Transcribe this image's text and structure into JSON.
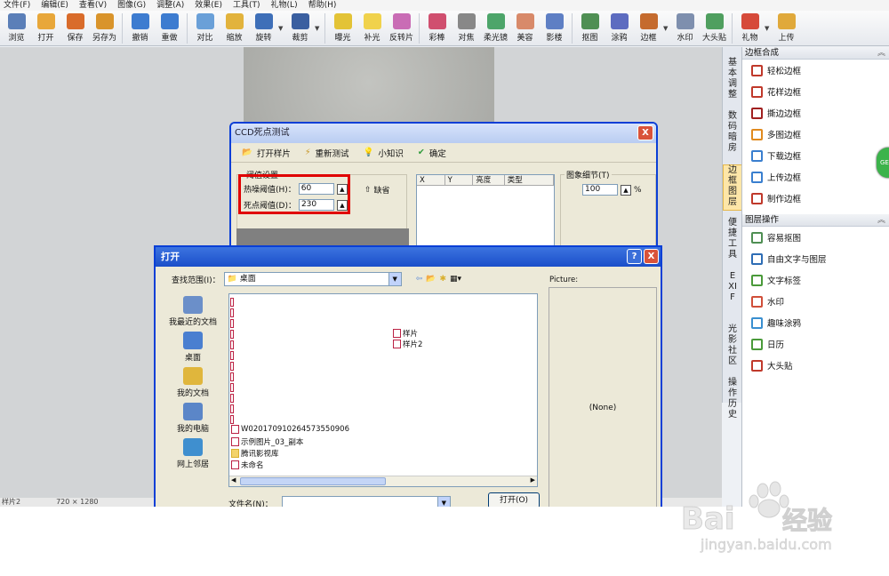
{
  "menu": [
    "文件(F)",
    "编辑(E)",
    "查看(V)",
    "图像(G)",
    "调整(A)",
    "效果(E)",
    "工具(T)",
    "礼物(L)",
    "帮助(H)"
  ],
  "toolbar": [
    {
      "label": "浏览",
      "icon": "browse-icon",
      "color": "#5b7fb8"
    },
    {
      "label": "打开",
      "icon": "open-icon",
      "color": "#e8a73a"
    },
    {
      "label": "保存",
      "icon": "save-icon",
      "color": "#d96c2b"
    },
    {
      "label": "另存为",
      "icon": "save-as-icon",
      "color": "#d9942b"
    },
    {
      "label": "撤销",
      "icon": "undo-icon",
      "color": "#3d7cd0"
    },
    {
      "label": "重做",
      "icon": "redo-icon",
      "color": "#3d7cd0"
    },
    {
      "label": "对比",
      "icon": "compare-icon",
      "color": "#6aa0d8"
    },
    {
      "label": "缩放",
      "icon": "zoom-icon",
      "color": "#e2b33c"
    },
    {
      "label": "旋转",
      "icon": "rotate-icon",
      "color": "#3e6fb8"
    },
    {
      "label": "裁剪",
      "icon": "crop-icon",
      "color": "#3a5fa0"
    },
    {
      "label": "曝光",
      "icon": "exposure-icon",
      "color": "#e3c336"
    },
    {
      "label": "补光",
      "icon": "fill-light-icon",
      "color": "#f0d24c"
    },
    {
      "label": "反转片",
      "icon": "reversal-film-icon",
      "color": "#c96cb5"
    },
    {
      "label": "彩棒",
      "icon": "color-wand-icon",
      "color": "#d04f6f"
    },
    {
      "label": "对焦",
      "icon": "focus-icon",
      "color": "#888888"
    },
    {
      "label": "柔光镜",
      "icon": "soft-lens-icon",
      "color": "#4da56a"
    },
    {
      "label": "美容",
      "icon": "beauty-icon",
      "color": "#d88a6a"
    },
    {
      "label": "影楼",
      "icon": "studio-icon",
      "color": "#5e7fc4"
    },
    {
      "label": "抠图",
      "icon": "cutout-icon",
      "color": "#4f8f53"
    },
    {
      "label": "涂鸦",
      "icon": "doodle-icon",
      "color": "#5d6cc0"
    },
    {
      "label": "边框",
      "icon": "frame-icon",
      "color": "#c56b2e"
    },
    {
      "label": "水印",
      "icon": "watermark-icon",
      "color": "#7e8fae"
    },
    {
      "label": "大头贴",
      "icon": "sticker-icon",
      "color": "#4f9f5f"
    },
    {
      "label": "礼物",
      "icon": "gift-icon",
      "color": "#d64a3a"
    },
    {
      "label": "上传",
      "icon": "upload-icon",
      "color": "#e0a93b"
    }
  ],
  "status": {
    "left": "样片2",
    "size": "720 × 1280"
  },
  "vtabs": [
    {
      "label": "基本调整",
      "active": false
    },
    {
      "label": "数码暗房",
      "active": false
    },
    {
      "label": "边框图层",
      "active": true
    },
    {
      "label": "便捷工具",
      "active": false
    },
    {
      "label": "EXIF",
      "active": false
    },
    {
      "label": "光影社区",
      "active": false
    },
    {
      "label": "操作历史",
      "active": false
    }
  ],
  "panel": {
    "frame_title": "边框合成",
    "frame_items": [
      {
        "label": "轻松边框",
        "icon": "easy-frame-icon",
        "color": "#c0392b"
      },
      {
        "label": "花样边框",
        "icon": "pattern-frame-icon",
        "color": "#c0392b"
      },
      {
        "label": "撕边边框",
        "icon": "torn-frame-icon",
        "color": "#a02020"
      },
      {
        "label": "多图边框",
        "icon": "multi-frame-icon",
        "color": "#e08a1e"
      },
      {
        "label": "下载边框",
        "icon": "download-frame-icon",
        "color": "#3a7fcf"
      },
      {
        "label": "上传边框",
        "icon": "upload-frame-icon",
        "color": "#3a7fcf"
      },
      {
        "label": "制作边框",
        "icon": "make-frame-icon",
        "color": "#c0392b"
      }
    ],
    "layer_title": "图层操作",
    "layer_items": [
      {
        "label": "容易抠图",
        "icon": "easy-cutout-icon",
        "color": "#4f8f53"
      },
      {
        "label": "自由文字与图层",
        "icon": "text-layer-icon",
        "color": "#2e6db5"
      },
      {
        "label": "文字标签",
        "icon": "text-tag-icon",
        "color": "#4a9a3a"
      },
      {
        "label": "水印",
        "icon": "watermark-icon",
        "color": "#d04f3a"
      },
      {
        "label": "趣味涂鸦",
        "icon": "fun-doodle-icon",
        "color": "#3a8fd0"
      },
      {
        "label": "日历",
        "icon": "calendar-icon",
        "color": "#4a9a3a"
      },
      {
        "label": "大头贴",
        "icon": "sticker-icon",
        "color": "#c0392b"
      }
    ]
  },
  "ccd": {
    "title": "CCD死点测试",
    "close": "X",
    "open_sample": "打开样片",
    "retest": "重新测试",
    "tips": "小知识",
    "ok": "确定",
    "threshold_group": "阈值设置",
    "hot_label": "热噪阈值(H)：",
    "hot_value": "60",
    "dead_label": "死点阈值(D)：",
    "dead_value": "230",
    "default_btn": "缺省",
    "cols": [
      "X",
      "Y",
      "亮度",
      "类型"
    ],
    "detail_group": "图象细节(T)",
    "detail_value": "100",
    "detail_unit": "%"
  },
  "open": {
    "title": "打开",
    "look_in_label": "查找范围(I)：",
    "look_in_value": "桌面",
    "places": [
      "我最近的文档",
      "桌面",
      "我的文档",
      "我的电脑",
      "网上邻居"
    ],
    "files_right": [
      "样片",
      "样片2"
    ],
    "files_bottom": [
      "W020170910264573550906",
      "示例图片_03_副本",
      "腾讯影视库",
      "未命名"
    ],
    "preview_label": "Picture:",
    "preview_none": "(None)",
    "filename_label": "文件名(N)：",
    "open_btn": "打开(O)",
    "help_btn": "?",
    "close_btn": "X"
  },
  "watermark": {
    "brand": "Bai",
    "brand2": "经验",
    "site": "jingyan.baidu.com"
  }
}
